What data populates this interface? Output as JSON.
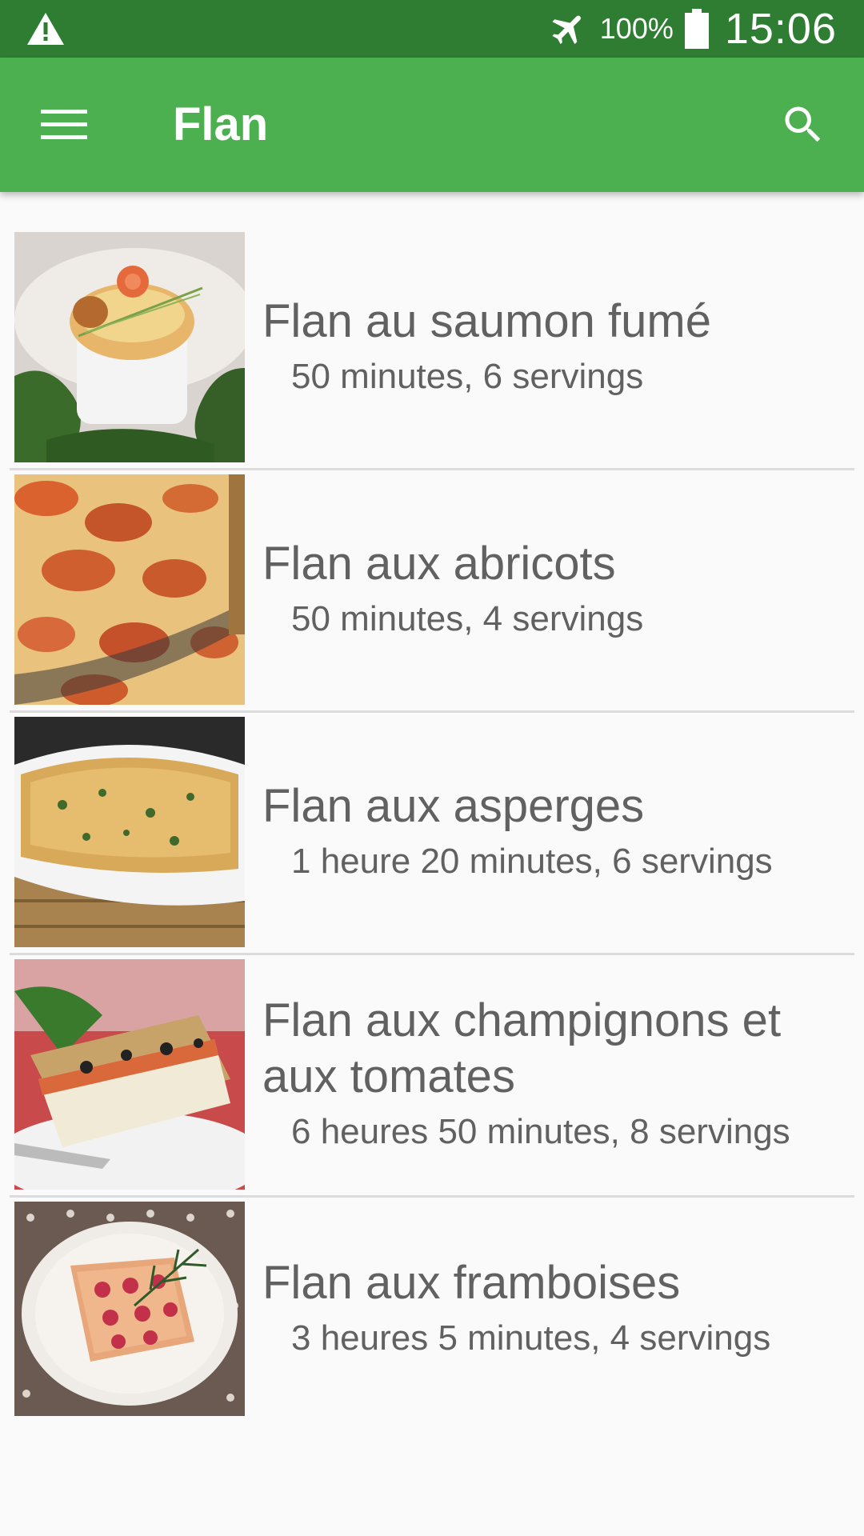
{
  "status_bar": {
    "battery_percent": "100%",
    "time": "15:06",
    "warning_icon": "warning-icon",
    "airplane_icon": "airplane-mode-icon",
    "battery_icon": "battery-full-icon"
  },
  "toolbar": {
    "title": "Flan",
    "menu_icon": "hamburger-menu-icon",
    "search_icon": "search-icon",
    "background_color": "#4caf50",
    "status_color": "#2e7d32"
  },
  "recipes": [
    {
      "title": "Flan au saumon fumé",
      "meta": "50 minutes, 6 servings"
    },
    {
      "title": "Flan aux abricots",
      "meta": "50 minutes, 4 servings"
    },
    {
      "title": "Flan aux asperges",
      "meta": "1 heure 20 minutes, 6 servings"
    },
    {
      "title": "Flan aux champignons et aux tomates",
      "meta": "6 heures 50 minutes, 8 servings"
    },
    {
      "title": "Flan aux framboises",
      "meta": "3 heures 5 minutes, 4 servings"
    }
  ]
}
